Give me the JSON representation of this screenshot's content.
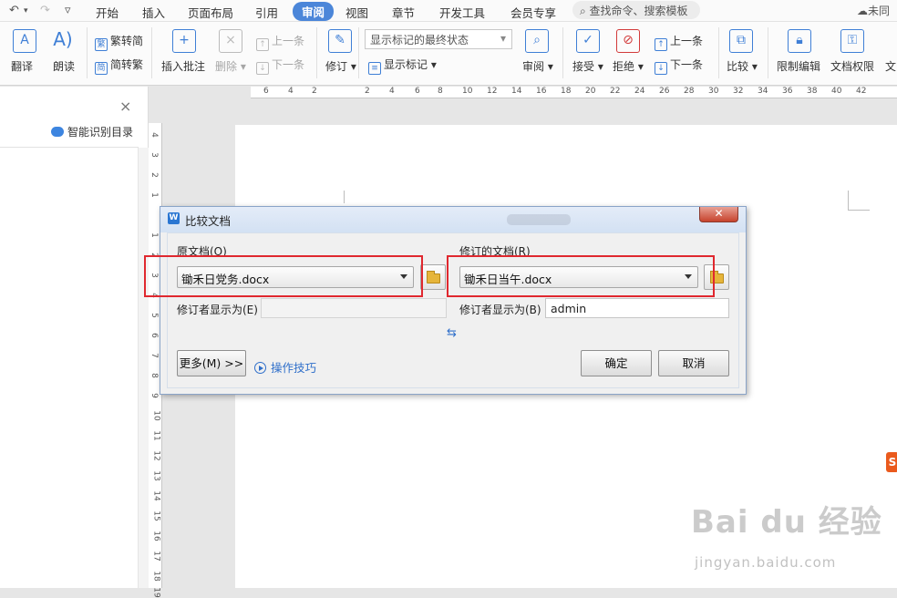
{
  "quickbar": {
    "undo": "↶",
    "undo_arrow": "▾",
    "redo": "↷",
    "customize": "▿"
  },
  "tabs": [
    "开始",
    "插入",
    "页面布局",
    "引用",
    "审阅",
    "视图",
    "章节",
    "开发工具",
    "会员专享"
  ],
  "active_tab": "审阅",
  "search": {
    "placeholder": "查找命令、搜索模板"
  },
  "cloud": {
    "label": "未同"
  },
  "ribbon": {
    "translate": "翻译",
    "read_aloud": "朗读",
    "trad_to_simp": "繁转简",
    "simp_to_trad": "简转繁",
    "insert_comment": "插入批注",
    "delete": "删除",
    "prev_comment": "上一条",
    "next_comment": "下一条",
    "track_changes": "修订",
    "markup_select": "显示标记的最终状态",
    "show_markup": "显示标记",
    "reviewing_pane": "审阅",
    "accept": "接受",
    "reject": "拒绝",
    "prev_change": "上一条",
    "next_change": "下一条",
    "compare": "比较",
    "restrict_editing": "限制编辑",
    "doc_permissions": "文档权限",
    "doc_more": "文"
  },
  "nav_pane": {
    "smart_toc": "智能识别目录",
    "close": "×"
  },
  "hruler_ticks": [
    "6",
    "4",
    "2",
    "2",
    "4",
    "6",
    "8",
    "10",
    "12",
    "14",
    "16",
    "18",
    "20",
    "22",
    "24",
    "26",
    "28",
    "30",
    "32",
    "34",
    "36",
    "38",
    "40",
    "42"
  ],
  "vruler_ticks": [
    "4",
    "3",
    "2",
    "1",
    "1",
    "2",
    "3",
    "4",
    "5",
    "6",
    "7",
    "8",
    "9",
    "10",
    "11",
    "12",
    "13",
    "14",
    "15",
    "16",
    "17",
    "18",
    "19"
  ],
  "dialog": {
    "title": "比较文档",
    "logo": "W",
    "close": "✕",
    "original_label": "原文档(O)",
    "original_file": "锄禾日党务.docx",
    "revised_label": "修订的文档(R)",
    "revised_file": "锄禾日当午.docx",
    "original_author_label": "修订者显示为(E)",
    "original_author_value": "",
    "revised_author_label": "修订者显示为(B)",
    "revised_author_value": "admin",
    "swap": "⇆",
    "more_button": "更多(M) >>",
    "tips": "操作技巧",
    "ok": "确定",
    "cancel": "取消"
  },
  "watermark": {
    "brand": "Bai du 经验",
    "url": "jingyan.baidu.com",
    "side_badge": "S"
  },
  "colors": {
    "accent": "#4b86d9",
    "highlight": "#e0282f",
    "link": "#2f6fca"
  }
}
